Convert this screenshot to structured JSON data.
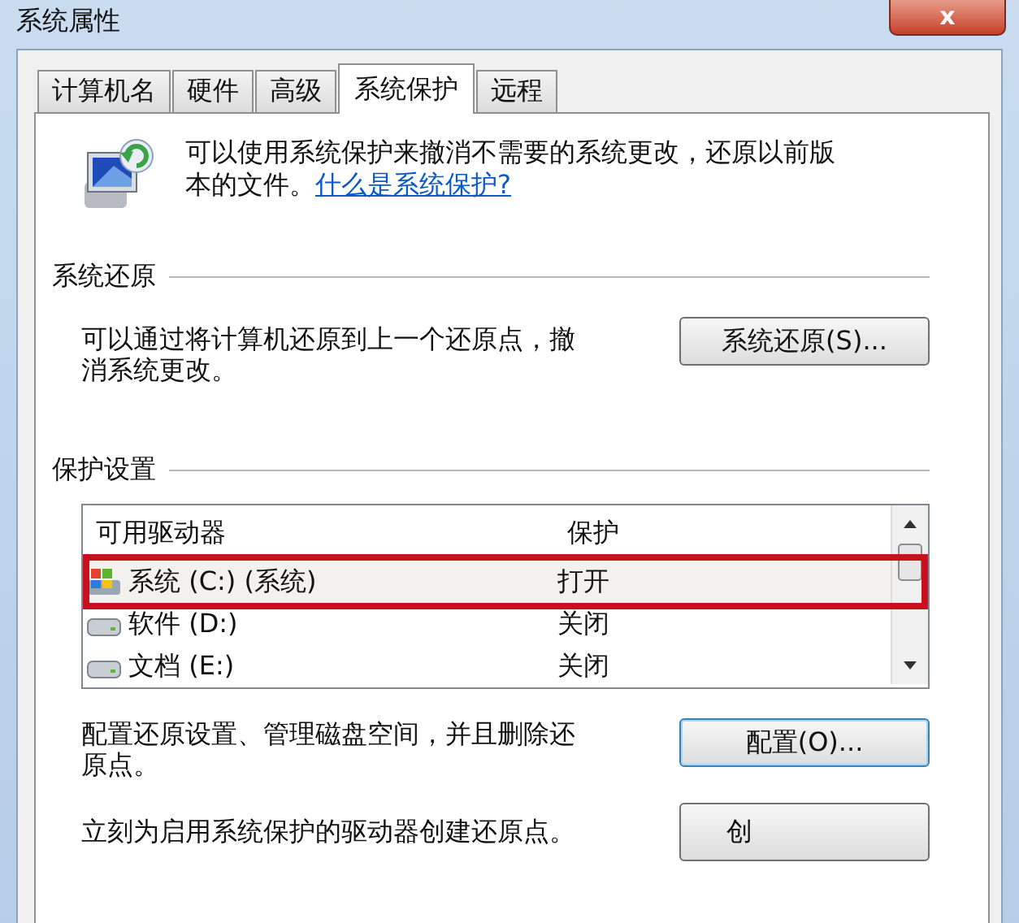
{
  "window": {
    "title": "系统属性",
    "close_label": "x"
  },
  "tabs": [
    {
      "label": "计算机名",
      "selected": false
    },
    {
      "label": "硬件",
      "selected": false
    },
    {
      "label": "高级",
      "selected": false
    },
    {
      "label": "系统保护",
      "selected": true
    },
    {
      "label": "远程",
      "selected": false
    }
  ],
  "intro": {
    "text": "可以使用系统保护来撤消不需要的系统更改，还原以前版本的文件。",
    "link": "什么是系统保护?"
  },
  "restore_section": {
    "heading": "系统还原",
    "text": "可以通过将计算机还原到上一个还原点，撤消系统更改。",
    "button": "系统还原(S)..."
  },
  "protection_section": {
    "heading": "保护设置",
    "table": {
      "columns": [
        "可用驱动器",
        "保护"
      ],
      "rows": [
        {
          "kind": "system",
          "drive": "系统 (C:) (系统)",
          "protection": "打开",
          "selected": true,
          "annotated": true
        },
        {
          "kind": "disk",
          "drive": "软件 (D:)",
          "protection": "关闭",
          "selected": false,
          "annotated": false
        },
        {
          "kind": "disk",
          "drive": "文档 (E:)",
          "protection": "关闭",
          "selected": false,
          "annotated": false
        }
      ]
    },
    "configure_text": "配置还原设置、管理磁盘空间，并且删除还原点。",
    "configure_button": "配置(O)...",
    "create_text": "立刻为启用系统保护的驱动器创建还原点。",
    "create_button": "创"
  }
}
